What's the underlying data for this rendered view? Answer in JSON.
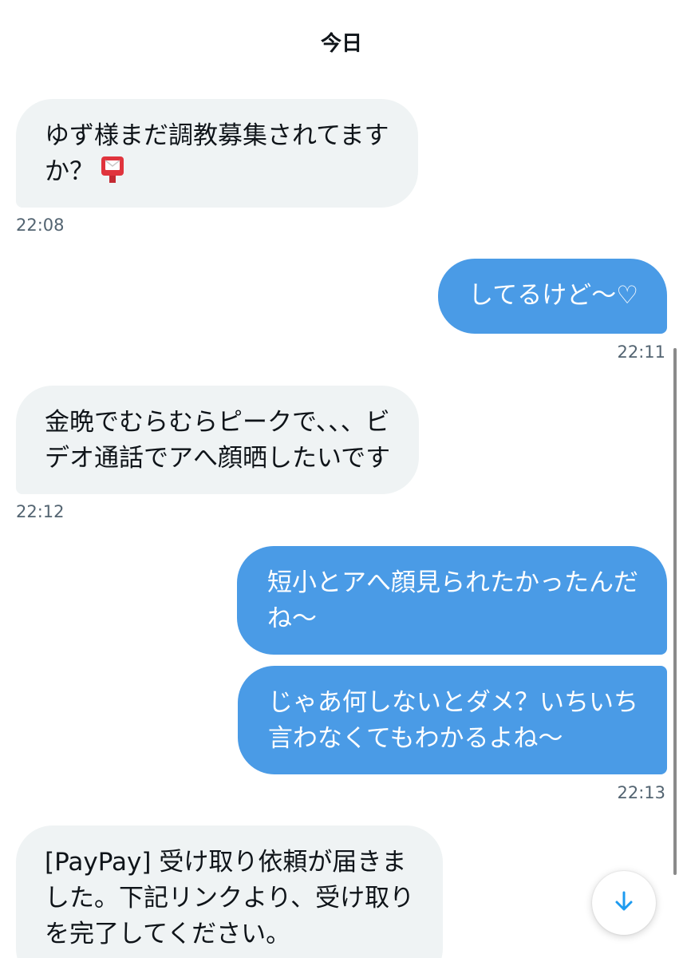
{
  "date_header": "今日",
  "messages": [
    {
      "side": "received",
      "lines": [
        "ゆず様まだ調教募集されてます",
        "か？"
      ],
      "emoji": "postbox-icon",
      "time": "22:08"
    },
    {
      "side": "sent",
      "lines": [
        "してるけど〜♡"
      ],
      "time": "22:11"
    },
    {
      "side": "received",
      "lines": [
        "金晩でむらむらピークで、、、ビ",
        "デオ通話でアへ顔晒したいです"
      ],
      "time": "22:12"
    },
    {
      "side": "sent",
      "lines": [
        "短小とアへ顔見られたかったんだ",
        "ね〜"
      ]
    },
    {
      "side": "sent",
      "lines": [
        "じゃあ何しないとダメ？いちいち",
        "言わなくてもわかるよね〜"
      ],
      "time": "22:13"
    },
    {
      "side": "received",
      "lines": [
        "[PayPay] 受け取り依頼が届きま",
        "した。下記リンクより、受け取り",
        "を完了してください。"
      ]
    }
  ],
  "scroll_down_icon": "arrow-down-icon",
  "colors": {
    "received_bubble": "#eff3f4",
    "sent_bubble": "#4a9be6",
    "timestamp": "#536471",
    "accent": "#1d9bf0"
  }
}
